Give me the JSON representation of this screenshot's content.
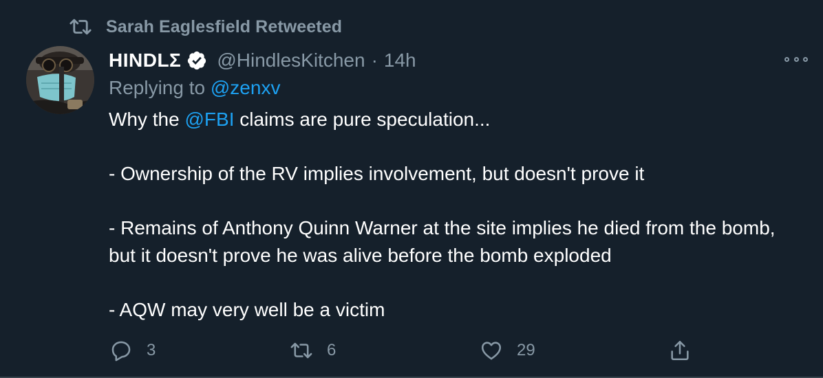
{
  "retweet_context": {
    "text": "Sarah Eaglesfield Retweeted",
    "icon": "retweet-icon"
  },
  "author": {
    "name": "HINDLΣ",
    "verified": true,
    "handle": "@HindlesKitchen",
    "separator": "·",
    "time": "14h"
  },
  "reply": {
    "prefix": "Replying to ",
    "mention": "@zenxv"
  },
  "content": {
    "line1": {
      "before": "Why the ",
      "mention": "@FBI",
      "after": " claims are pure speculation..."
    },
    "paragraphs": [
      "- Ownership of the RV implies involvement, but doesn't prove it",
      "- Remains of Anthony Quinn Warner at the site implies he died from the bomb, but it doesn't prove he was alive before the bomb exploded",
      "- AQW may very well be a victim"
    ]
  },
  "actions": {
    "replies": "3",
    "retweets": "6",
    "likes": "29"
  },
  "colors": {
    "background": "#15202b",
    "secondary_text": "#8899a6",
    "link": "#1da1f2",
    "primary_text": "#ffffff"
  }
}
